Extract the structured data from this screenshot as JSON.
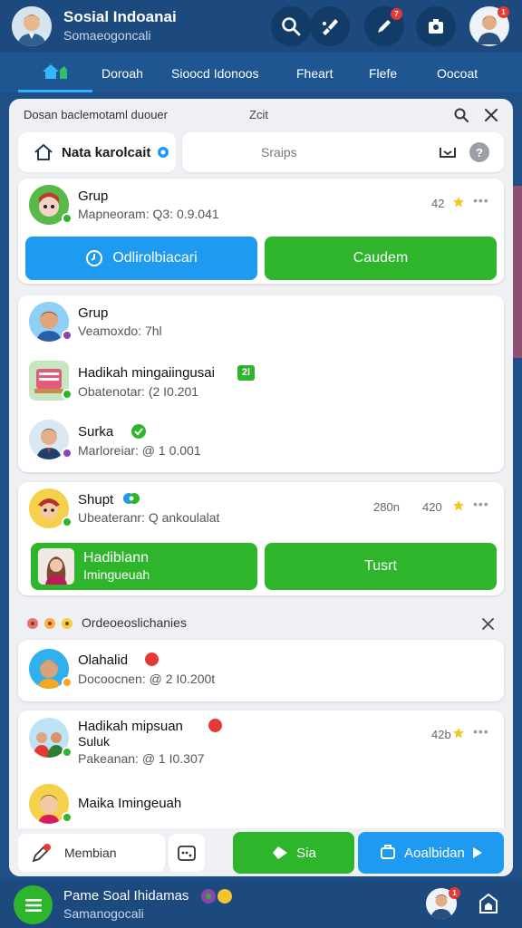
{
  "header": {
    "title": "Sosial Indoanai",
    "subtitle": "Somaeogoncali",
    "notif_count": "7",
    "profile_badge": "1"
  },
  "nav": {
    "tabs": [
      "Doroah",
      "Sioocd Idonoos",
      "Fheart",
      "Flefe",
      "Oocoat"
    ]
  },
  "panel": {
    "title": "Dosan baclemotaml duouer",
    "edit": "Zcit",
    "name_chip": "Nata karolcait",
    "search_placeholder": "Sraips"
  },
  "card1": {
    "name": "Grup",
    "sub": "Mapneoram: Q3: 0.9.041",
    "count": "42",
    "primary_btn": "Odlirolbiacari",
    "secondary_btn": "Caudem"
  },
  "card2": {
    "rows": [
      {
        "name": "Grup",
        "sub": "Veamoxdo: 7hl"
      },
      {
        "name": "Hadikah mingaiingusai",
        "badge": "2l",
        "sub": "Obatenotar: (2 I0.201"
      },
      {
        "name": "Surka",
        "sub": "Marloreiar: @ 1 0.001"
      }
    ]
  },
  "card3": {
    "name": "Shupt",
    "sub": "Ubeateranr: Q ankoulalat",
    "time": "280n",
    "count": "420",
    "btn_primary_line1": "Hadiblann",
    "btn_primary_line2": "Imingueuah",
    "btn_secondary": "Tusrt"
  },
  "notice": {
    "text": "Ordeoeoslichanies"
  },
  "card4": {
    "name": "Olahalid",
    "sub": "Docoocnen: @ 2 I0.200t"
  },
  "card5": {
    "rows": [
      {
        "name": "Hadikah mipsuan",
        "name2": "Suluk",
        "sub": "Pakeanan: @ 1 I0.307",
        "count": "42b"
      },
      {
        "name": "Maika Imingeuah"
      }
    ]
  },
  "actions": {
    "compose": "Membian",
    "send": "Sia",
    "share": "Aoalbidan"
  },
  "footer": {
    "title": "Pame Soal Ihidamas",
    "subtitle": "Samanogocali",
    "profile_badge": "1"
  },
  "colors": {
    "primary_blue": "#1e9bf0",
    "primary_green": "#2fb52c",
    "header_blue": "#1c4a7e"
  }
}
